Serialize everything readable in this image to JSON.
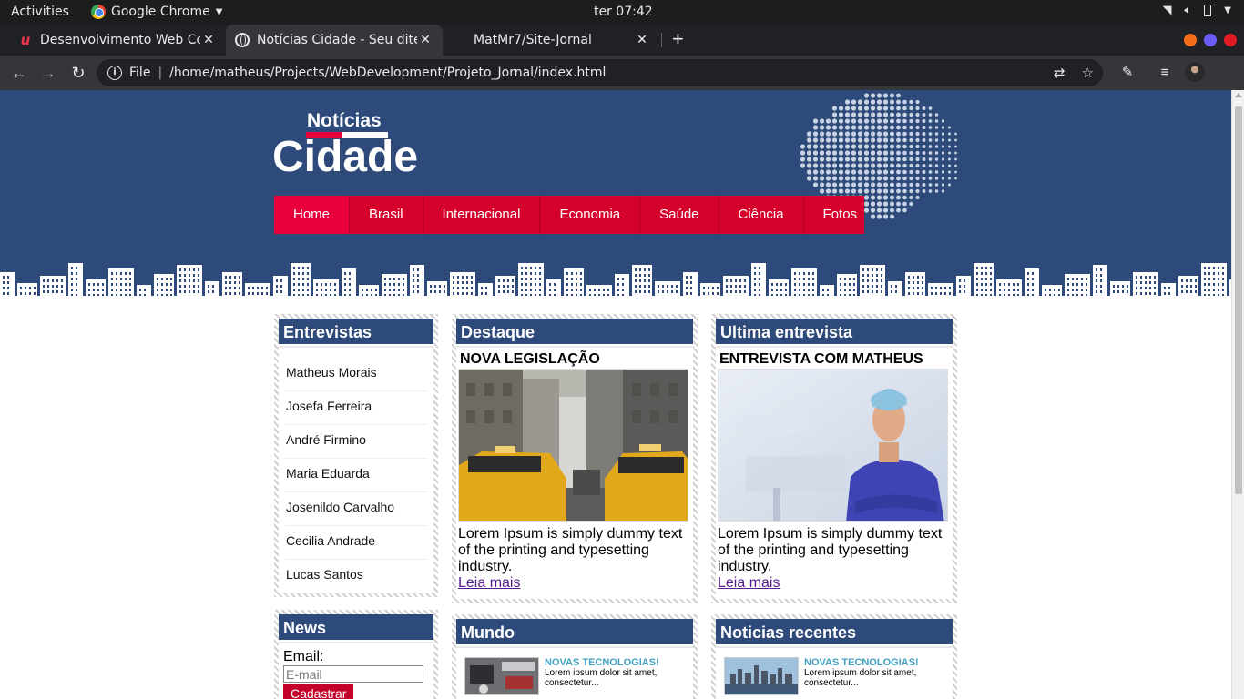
{
  "system_bar": {
    "activities": "Activities",
    "app_name": "Google Chrome",
    "clock": "ter 07:42"
  },
  "browser": {
    "tabs": [
      {
        "title": "Desenvolvimento Web Completo",
        "icon": "udemy-icon"
      },
      {
        "title": "Notícias Cidade - Seu diteiro de notícias",
        "icon": "globe-icon"
      },
      {
        "title": "MatMr7/Site-Jornal",
        "icon": "github-icon"
      }
    ],
    "address": {
      "scheme_label": "File",
      "url": "/home/matheus/Projects/WebDevelopment/Projeto_Jornal/index.html"
    },
    "window_dot_colors": [
      "#f46d1b",
      "#6a5cf5",
      "#e01b24"
    ]
  },
  "site": {
    "logo_top": "Notícias",
    "logo_main": "Cidade",
    "nav": [
      "Home",
      "Brasil",
      "Internacional",
      "Economia",
      "Saúde",
      "Ciência",
      "Fotos"
    ],
    "colors": {
      "header": "#2e4a7a",
      "nav": "#d5032b",
      "nav_active": "#e8003c",
      "widget_title": "#2e4a7a"
    },
    "entrevistas": {
      "title": "Entrevistas",
      "items": [
        "Matheus Morais",
        "Josefa Ferreira",
        "André Firmino",
        "Maria Eduarda",
        "Josenildo Carvalho",
        "Cecilia Andrade",
        "Lucas Santos"
      ]
    },
    "news": {
      "title": "News",
      "email_label": "Email:",
      "email_placeholder": "E-mail",
      "submit_label": "Cadastrar"
    },
    "destaque": {
      "title": "Destaque",
      "headline": "NOVA LEGISLAÇÃO",
      "text": "Lorem Ipsum is simply dummy text of the printing and typesetting industry.",
      "link": "Leia mais"
    },
    "ultima": {
      "title": "Ultima entrevista",
      "headline": "ENTREVISTA COM MATHEUS",
      "text": "Lorem Ipsum is simply dummy text of the printing and typesetting industry.",
      "link": "Leia mais"
    },
    "mundo": {
      "title": "Mundo",
      "item": {
        "title": "NOVAS TECNOLOGIAS!",
        "desc": "Lorem ipsum dolor sit amet, consectetur..."
      }
    },
    "recentes": {
      "title": "Noticias recentes",
      "item": {
        "title": "NOVAS TECNOLOGIAS!",
        "desc": "Lorem ipsum dolor sit amet, consectetur..."
      }
    }
  }
}
